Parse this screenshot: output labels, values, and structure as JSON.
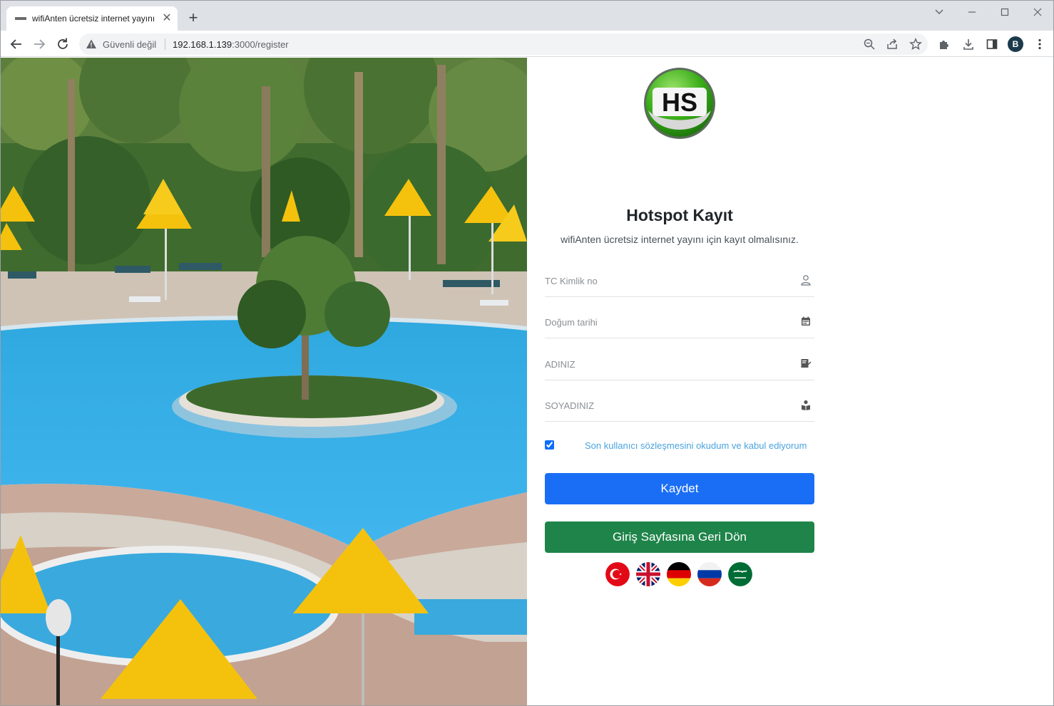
{
  "browser": {
    "tab_title": "wifiAnten ücretsiz internet yayını",
    "security_label": "Güvenli değil",
    "url_host": "192.168.1.139",
    "url_rest": ":3000/register",
    "profile_initial": "B"
  },
  "logo_text": "HS",
  "form": {
    "title": "Hotspot Kayıt",
    "subtitle": "wifiAnten ücretsiz internet yayını için kayıt olmalısınız.",
    "fields": [
      {
        "placeholder": "TC Kimlik no",
        "icon": "user-icon"
      },
      {
        "placeholder": "Doğum tarihi",
        "icon": "calendar-icon"
      },
      {
        "placeholder": "ADINIZ",
        "icon": "signature-icon"
      },
      {
        "placeholder": "SOYADINIZ",
        "icon": "id-icon"
      }
    ],
    "terms_label": "Son kullanıcı sözleşmesini okudum ve kabul ediyorum",
    "terms_checked": true,
    "submit_label": "Kaydet",
    "back_label": "Giriş Sayfasına Geri Dön"
  },
  "languages": [
    "tr",
    "en",
    "de",
    "ru",
    "ar"
  ],
  "colors": {
    "primary": "#1a6ef5",
    "success": "#1e8449",
    "link": "#4aa3df"
  }
}
